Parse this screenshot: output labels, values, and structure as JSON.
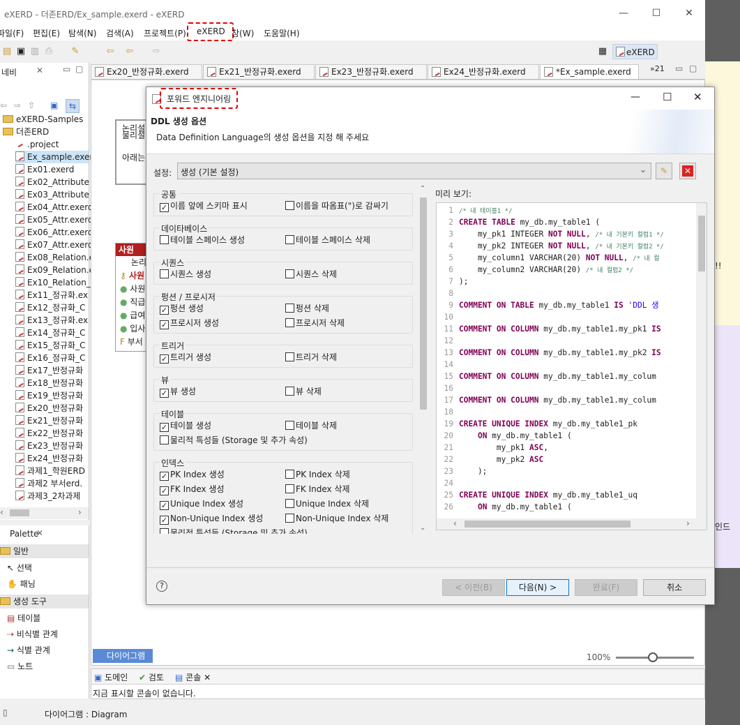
{
  "window": {
    "title": "eXERD - 더존ERD/Ex_sample.exerd - eXERD"
  },
  "menu": [
    "파일(F)",
    "편집(E)",
    "탐색(N)",
    "검색(A)",
    "프로젝트(P)",
    "eXERD",
    "창(W)",
    "도움말(H)"
  ],
  "perspective": "eXERD",
  "nav": {
    "title": "네비",
    "items": [
      "eXERD-Samples",
      "더존ERD",
      ".project",
      "Ex_sample.exer",
      "Ex01.exerd",
      "Ex02_Attribute",
      "Ex03_Attribute",
      "Ex04_Attr.exerd",
      "Ex05_Attr.exerd",
      "Ex06_Attr.exerd",
      "Ex07_Attr.exerd",
      "Ex08_Relation.e",
      "Ex09_Relation.e",
      "Ex10_Relation_",
      "Ex11_정규화.ex",
      "Ex12_정규화_C",
      "Ex13_정규화.ex",
      "Ex14_정규화_C",
      "Ex15_정규화_C",
      "Ex16_정규화_C",
      "Ex17_반정규화",
      "Ex18_반정규화",
      "Ex19_반정규화",
      "Ex20_반정규화",
      "Ex21_반정규화",
      "Ex22_반정규화",
      "Ex23_반정규화",
      "Ex24_반정규화",
      "과제1_학원ERD",
      "과제2 부서erd.",
      "과제3_2차과제"
    ]
  },
  "palette": {
    "title": "Palette",
    "general": "일반",
    "select": "선택",
    "pan": "패닝",
    "tools": "생성 도구",
    "table": "테이블",
    "nonid": "비식별 관계",
    "idrel": "식별 관계",
    "note": "노트"
  },
  "tabs": [
    "Ex20_반정규화.exerd",
    "Ex21_반정규화.exerd",
    "Ex23_반정규화.exerd",
    "Ex24_반정규화.exerd",
    "*Ex_sample.exerd"
  ],
  "tabs_more": "»21",
  "editor": {
    "note_lines": [
      "논리설",
      "물리설",
      "아래는"
    ],
    "entity_title": "사원",
    "entity_rows": [
      "논리",
      "사원",
      "사원",
      "직급",
      "급여",
      "입사",
      "부서"
    ],
    "diagram_tab": "다이어그램",
    "zoom": "100%",
    "right_fragment": "인드",
    "right_fragment2": "!!"
  },
  "console": {
    "tabs": [
      "도메인",
      "검토",
      "콘솔"
    ],
    "message": "지금 표시할 콘솔이 없습니다."
  },
  "status": {
    "text": "다이어그램 : Diagram"
  },
  "dialog": {
    "title": "포워드 엔지니어링",
    "heading": "DDL 생성 옵션",
    "description": "Data Definition Language의 생성 옵션을 지정 해 주세요",
    "setting_label": "설정:",
    "setting_value": "생성 (기본 설정)",
    "preview_label": "미리 보기:",
    "groups": [
      {
        "name": "공통",
        "opts": [
          {
            "label": "이름 앞에 스키마 표시",
            "checked": true
          },
          {
            "label": "이름을 따옴표(\")로 감싸기",
            "checked": false
          }
        ]
      },
      {
        "name": "데이타베이스",
        "opts": [
          {
            "label": "테이블 스페이스 생성",
            "checked": false
          },
          {
            "label": "테이블 스페이스 삭제",
            "checked": false
          }
        ]
      },
      {
        "name": "시퀀스",
        "opts": [
          {
            "label": "시퀀스 생성",
            "checked": false
          },
          {
            "label": "시퀀스 삭제",
            "checked": false
          }
        ]
      },
      {
        "name": "펑션 / 프로시저",
        "opts": [
          {
            "label": "펑션 생성",
            "checked": true
          },
          {
            "label": "펑션 삭제",
            "checked": false
          },
          {
            "label": "프로시저 생성",
            "checked": true
          },
          {
            "label": "프로시저 삭제",
            "checked": false
          }
        ]
      },
      {
        "name": "트리거",
        "opts": [
          {
            "label": "트리거 생성",
            "checked": true
          },
          {
            "label": "트리거 삭제",
            "checked": false
          }
        ]
      },
      {
        "name": "뷰",
        "opts": [
          {
            "label": "뷰 생성",
            "checked": true
          },
          {
            "label": "뷰 삭제",
            "checked": false
          }
        ]
      },
      {
        "name": "테이블",
        "opts": [
          {
            "label": "테이블 생성",
            "checked": true
          },
          {
            "label": "테이블 삭제",
            "checked": false
          },
          {
            "label": "물리적 특성들 (Storage 및 추가 속성)",
            "checked": false
          }
        ]
      },
      {
        "name": "인덱스",
        "opts": [
          {
            "label": "PK Index 생성",
            "checked": true
          },
          {
            "label": "PK Index 삭제",
            "checked": false
          },
          {
            "label": "FK Index 생성",
            "checked": true
          },
          {
            "label": "FK Index 삭제",
            "checked": false
          },
          {
            "label": "Unique Index 생성",
            "checked": true
          },
          {
            "label": "Unique Index 삭제",
            "checked": false
          },
          {
            "label": "Non-Unique Index 생성",
            "checked": true
          },
          {
            "label": "Non-Unique Index 삭제",
            "checked": false
          },
          {
            "label": "물리적 특성들 (Storage 및 추가 속성)",
            "checked": false
          }
        ]
      }
    ],
    "code": [
      {
        "n": "1",
        "html": "<span class='cm'>/* 내 테이블1 */</span>"
      },
      {
        "n": "2",
        "html": "<span class='k'>CREATE TABLE</span> my_db.my_table1 ("
      },
      {
        "n": "3",
        "html": "    my_pk1 INTEGER <span class='k'>NOT NULL</span>, <span class='cm'>/* 내 기본키 컬럼1 */</span>"
      },
      {
        "n": "4",
        "html": "    my_pk2 INTEGER <span class='k'>NOT NULL</span>, <span class='cm'>/* 내 기본키 컬럼2 */</span>"
      },
      {
        "n": "5",
        "html": "    my_column1 VARCHAR(20) <span class='k'>NOT NULL</span>, <span class='cm'>/* 내 컬</span>"
      },
      {
        "n": "6",
        "html": "    my_column2 VARCHAR(20) <span class='cm'>/* 내 컬럼2 */</span>"
      },
      {
        "n": "7",
        "html": ");"
      },
      {
        "n": "8",
        "html": ""
      },
      {
        "n": "9",
        "html": "<span class='k'>COMMENT ON TABLE</span> my_db.my_table1 <span class='k'>IS</span> <span class='s'>'DDL 생</span>"
      },
      {
        "n": "10",
        "html": ""
      },
      {
        "n": "11",
        "html": "<span class='k'>COMMENT ON COLUMN</span> my_db.my_table1.my_pk1 <span class='k'>IS</span>"
      },
      {
        "n": "12",
        "html": ""
      },
      {
        "n": "13",
        "html": "<span class='k'>COMMENT ON COLUMN</span> my_db.my_table1.my_pk2 <span class='k'>IS</span>"
      },
      {
        "n": "14",
        "html": ""
      },
      {
        "n": "15",
        "html": "<span class='k'>COMMENT ON COLUMN</span> my_db.my_table1.my_colum"
      },
      {
        "n": "16",
        "html": ""
      },
      {
        "n": "17",
        "html": "<span class='k'>COMMENT ON COLUMN</span> my_db.my_table1.my_colum"
      },
      {
        "n": "18",
        "html": ""
      },
      {
        "n": "19",
        "html": "<span class='k'>CREATE UNIQUE INDEX</span> my_db.my_table1_pk"
      },
      {
        "n": "20",
        "html": "    <span class='k'>ON</span> my_db.my_table1 ("
      },
      {
        "n": "21",
        "html": "        my_pk1 <span class='k'>ASC</span>,"
      },
      {
        "n": "22",
        "html": "        my_pk2 <span class='k'>ASC</span>"
      },
      {
        "n": "23",
        "html": "    );"
      },
      {
        "n": "24",
        "html": ""
      },
      {
        "n": "25",
        "html": "<span class='k'>CREATE UNIQUE INDEX</span> my_db.my_table1_uq"
      },
      {
        "n": "26",
        "html": "    <span class='k'>ON</span> my_db.my_table1 ("
      }
    ],
    "buttons": {
      "back": "< 이전(B)",
      "next": "다음(N) >",
      "finish": "완료(F)",
      "cancel": "취소"
    }
  }
}
